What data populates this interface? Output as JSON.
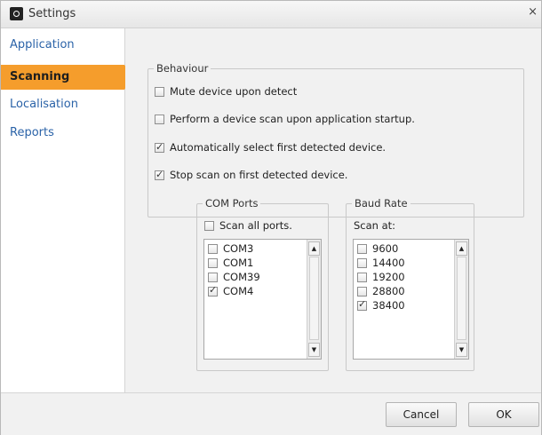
{
  "window": {
    "title": "Settings",
    "close_glyph": "×"
  },
  "sidebar": {
    "items": [
      {
        "label": "Application",
        "active": false
      },
      {
        "label": "Scanning",
        "active": true
      },
      {
        "label": "Localisation",
        "active": false
      },
      {
        "label": "Reports",
        "active": false
      }
    ]
  },
  "behaviour": {
    "legend": "Behaviour",
    "options": [
      {
        "label": "Mute device upon detect",
        "checked": false
      },
      {
        "label": "Perform a device scan upon application startup.",
        "checked": false
      },
      {
        "label": "Automatically select first detected device.",
        "checked": true
      },
      {
        "label": "Stop scan on first detected device.",
        "checked": true
      }
    ]
  },
  "com_ports": {
    "legend": "COM Ports",
    "scan_all_label": "Scan all ports.",
    "scan_all_checked": false,
    "ports": [
      {
        "label": "COM3",
        "checked": false
      },
      {
        "label": "COM1",
        "checked": false
      },
      {
        "label": "COM39",
        "checked": false
      },
      {
        "label": "COM4",
        "checked": true
      }
    ]
  },
  "baud_rate": {
    "legend": "Baud Rate",
    "scan_at_label": "Scan at:",
    "rates": [
      {
        "label": "9600",
        "checked": false
      },
      {
        "label": "14400",
        "checked": false
      },
      {
        "label": "19200",
        "checked": false
      },
      {
        "label": "28800",
        "checked": false
      },
      {
        "label": "38400",
        "checked": true
      }
    ]
  },
  "footer": {
    "cancel_label": "Cancel",
    "ok_label": "OK"
  },
  "colors": {
    "accent": "#f59d2c",
    "link": "#2b63a8"
  },
  "icons": {
    "app": "settings-app-icon",
    "scroll_up": "scroll-up-arrow-icon",
    "scroll_down": "scroll-down-arrow-icon"
  }
}
